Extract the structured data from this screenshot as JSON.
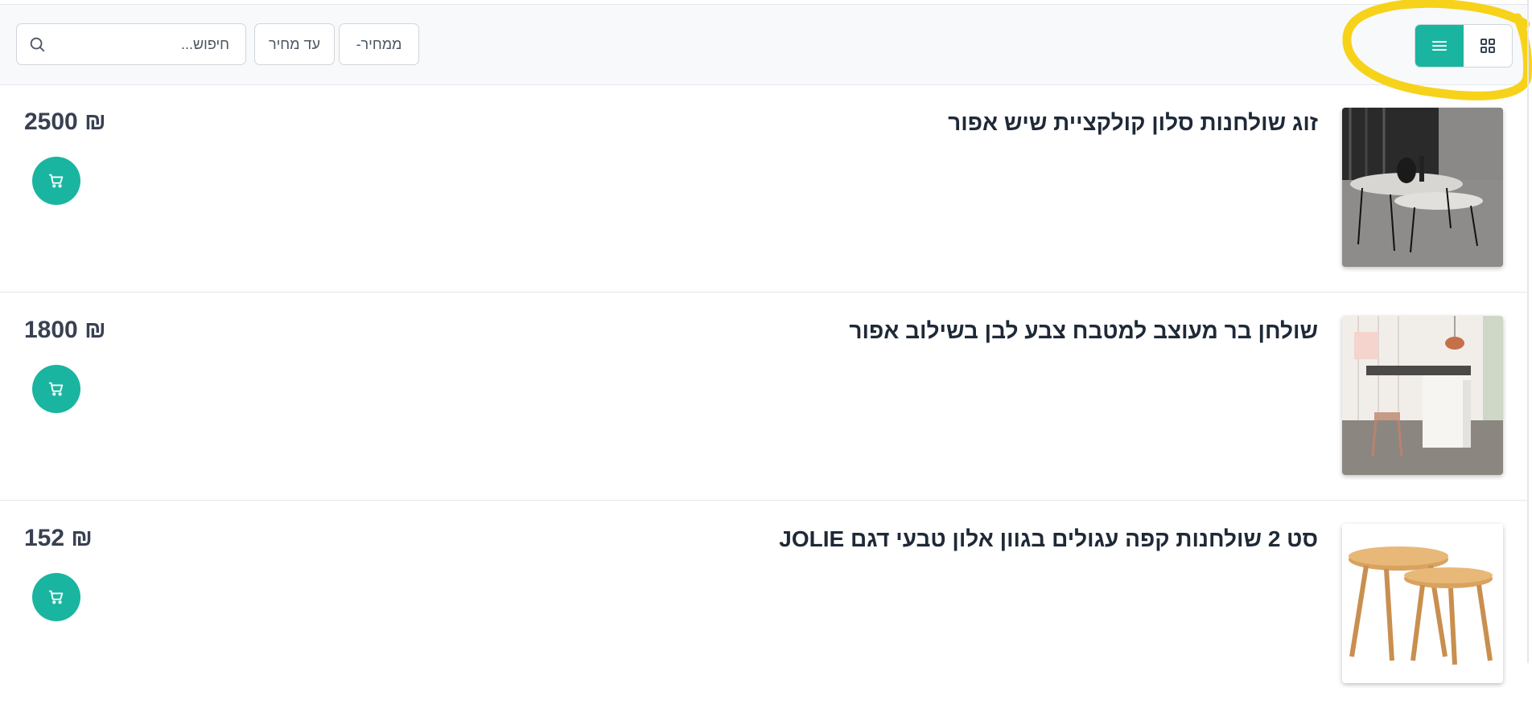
{
  "toolbar": {
    "search_placeholder": "חיפוש...",
    "price_from_label": "ממחיר-",
    "price_to_label": "עד מחיר",
    "view_list_icon": "list-icon",
    "view_grid_icon": "grid-icon",
    "accent_color": "#1ab5a0"
  },
  "products": [
    {
      "title": "זוג שולחנות סלון קולקציית שיש אפור",
      "price": "2500 ₪",
      "cart_icon": "cart-icon"
    },
    {
      "title": "שולחן בר מעוצב למטבח צבע לבן בשילוב אפור",
      "price": "1800 ₪",
      "cart_icon": "cart-icon"
    },
    {
      "title": "סט 2 שולחנות קפה עגולים בגוון אלון טבעי דגם JOLIE",
      "price": "152 ₪",
      "cart_icon": "cart-icon"
    }
  ]
}
